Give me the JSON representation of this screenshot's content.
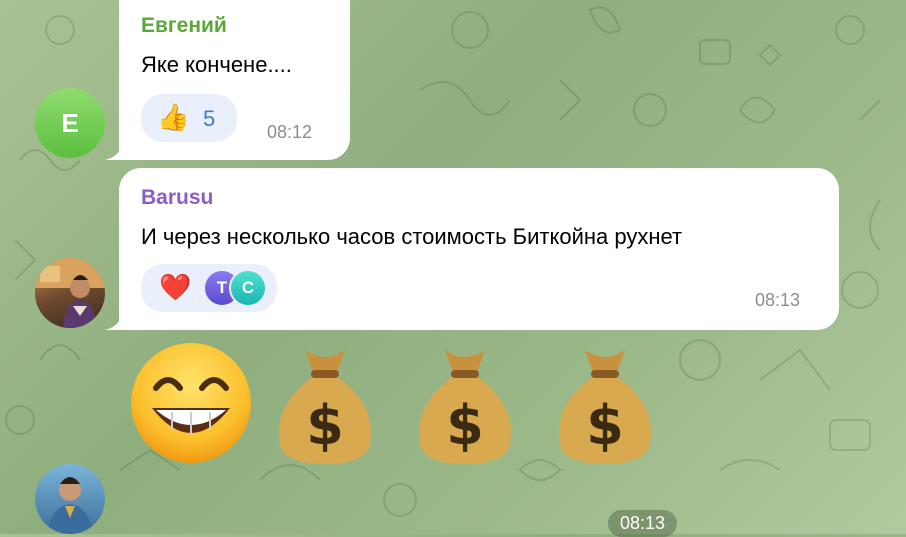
{
  "messages": [
    {
      "sender": "Евгений",
      "sender_color": "#5aa83a",
      "text": "Яке кончене....",
      "reaction_count": "5",
      "time": "08:12",
      "avatar_letter": "Е"
    },
    {
      "sender": "Barusu",
      "sender_color": "#8e5cc8",
      "text": "И через несколько часов стоимость Биткойна рухнет",
      "reactor_initials": [
        "Т",
        "С"
      ],
      "time": "08:13"
    },
    {
      "emoji_sticker": "😁💰💰💰",
      "time": "08:13"
    }
  ]
}
